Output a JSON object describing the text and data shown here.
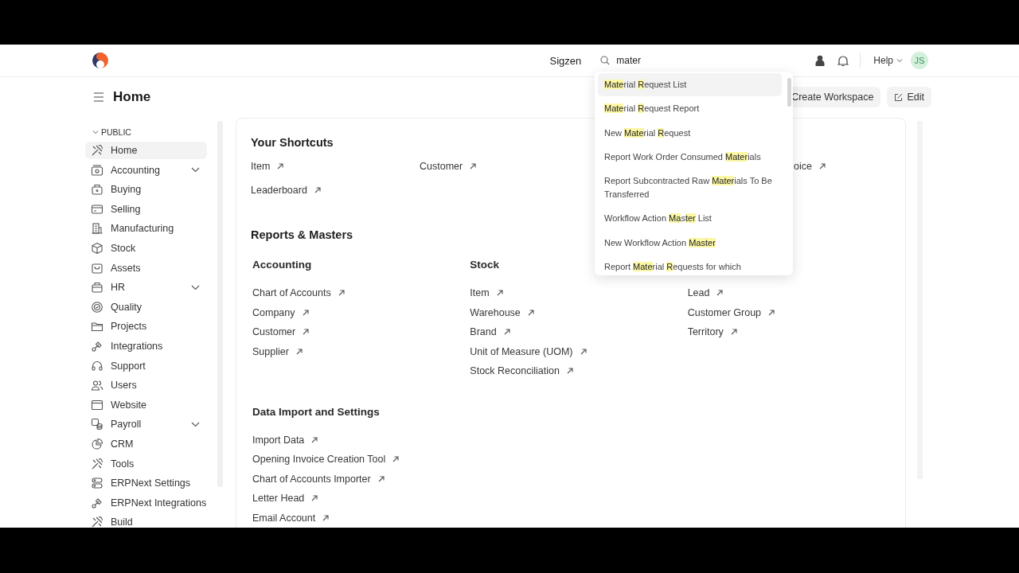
{
  "top_bar": {
    "brand": "Sigzen",
    "search": {
      "value": "mater"
    },
    "help": "Help",
    "avatar": "JS"
  },
  "search_results": [
    {
      "selected": true,
      "segments": [
        {
          "text": "Mate",
          "highlighted": true
        },
        {
          "text": "rial ",
          "highlighted": false
        },
        {
          "text": "R",
          "highlighted": true
        },
        {
          "text": "equest List",
          "highlighted": false
        }
      ]
    },
    {
      "selected": false,
      "segments": [
        {
          "text": "Mate",
          "highlighted": true
        },
        {
          "text": "rial ",
          "highlighted": false
        },
        {
          "text": "R",
          "highlighted": true
        },
        {
          "text": "equest Report",
          "highlighted": false
        }
      ]
    },
    {
      "selected": false,
      "segments": [
        {
          "text": "New ",
          "highlighted": false
        },
        {
          "text": "Mate",
          "highlighted": true
        },
        {
          "text": "rial ",
          "highlighted": false
        },
        {
          "text": "R",
          "highlighted": true
        },
        {
          "text": "equest",
          "highlighted": false
        }
      ]
    },
    {
      "selected": false,
      "segments": [
        {
          "text": "Report Work Order Consumed ",
          "highlighted": false
        },
        {
          "text": "Mater",
          "highlighted": true
        },
        {
          "text": "ials",
          "highlighted": false
        }
      ]
    },
    {
      "selected": false,
      "segments": [
        {
          "text": "Report Subcontracted Raw ",
          "highlighted": false
        },
        {
          "text": "Mater",
          "highlighted": true
        },
        {
          "text": "ials To Be Transferred",
          "highlighted": false
        }
      ]
    },
    {
      "selected": false,
      "segments": [
        {
          "text": "Workflow Action ",
          "highlighted": false
        },
        {
          "text": "Ma",
          "highlighted": true
        },
        {
          "text": "s",
          "highlighted": false
        },
        {
          "text": "ter",
          "highlighted": true
        },
        {
          "text": " List",
          "highlighted": false
        }
      ]
    },
    {
      "selected": false,
      "segments": [
        {
          "text": "New Workflow Action ",
          "highlighted": false
        },
        {
          "text": "Master",
          "highlighted": true
        }
      ]
    },
    {
      "selected": false,
      "segments": [
        {
          "text": "Report ",
          "highlighted": false
        },
        {
          "text": "Mate",
          "highlighted": true
        },
        {
          "text": "rial ",
          "highlighted": false
        },
        {
          "text": "R",
          "highlighted": true
        },
        {
          "text": "equests for which",
          "highlighted": false
        }
      ]
    }
  ],
  "page": {
    "title": "Home",
    "buttons": [
      {
        "kind": "plain",
        "label": "Create Workspace"
      },
      {
        "kind": "edit",
        "label": "Edit"
      }
    ]
  },
  "sidebar": {
    "section": "PUBLIC",
    "expanded": true,
    "items": [
      {
        "label": "Home",
        "selected": true,
        "has_children": false
      },
      {
        "label": "Accounting",
        "selected": false,
        "has_children": true
      },
      {
        "label": "Buying",
        "selected": false,
        "has_children": false
      },
      {
        "label": "Selling",
        "selected": false,
        "has_children": false
      },
      {
        "label": "Manufacturing",
        "selected": false,
        "has_children": false
      },
      {
        "label": "Stock",
        "selected": false,
        "has_children": false
      },
      {
        "label": "Assets",
        "selected": false,
        "has_children": false
      },
      {
        "label": "HR",
        "selected": false,
        "has_children": true
      },
      {
        "label": "Quality",
        "selected": false,
        "has_children": false
      },
      {
        "label": "Projects",
        "selected": false,
        "has_children": false
      },
      {
        "label": "Integrations",
        "selected": false,
        "has_children": false
      },
      {
        "label": "Support",
        "selected": false,
        "has_children": false
      },
      {
        "label": "Users",
        "selected": false,
        "has_children": false
      },
      {
        "label": "Website",
        "selected": false,
        "has_children": false
      },
      {
        "label": "Payroll",
        "selected": false,
        "has_children": true
      },
      {
        "label": "CRM",
        "selected": false,
        "has_children": false
      },
      {
        "label": "Tools",
        "selected": false,
        "has_children": false
      },
      {
        "label": "ERPNext Settings",
        "selected": false,
        "has_children": false
      },
      {
        "label": "ERPNext Integrations",
        "selected": false,
        "has_children": false
      },
      {
        "label": "Build",
        "selected": false,
        "has_children": false
      }
    ]
  },
  "shortcuts": {
    "title": "Your Shortcuts",
    "items": [
      {
        "label": "Item",
        "link_icon": true
      },
      {
        "label": "Customer",
        "link_icon": true
      },
      {
        "label": "oice",
        "link_icon": true
      },
      {
        "label": "Leaderboard",
        "link_icon": true
      }
    ]
  },
  "reports": {
    "title": "Reports & Masters",
    "groups": [
      {
        "title": "Accounting",
        "links": [
          "Chart of Accounts",
          "Company",
          "Customer",
          "Supplier"
        ]
      },
      {
        "title": "Stock",
        "links": [
          "Item",
          "Warehouse",
          "Brand",
          "Unit of Measure (UOM)",
          "Stock Reconciliation"
        ]
      },
      {
        "links": [
          "Lead",
          "Customer Group",
          "Territory"
        ]
      }
    ]
  },
  "data_import": {
    "title": "Data Import and Settings",
    "links": [
      "Import Data",
      "Opening Invoice Creation Tool",
      "Chart of Accounts Importer",
      "Letter Head",
      "Email Account"
    ]
  }
}
